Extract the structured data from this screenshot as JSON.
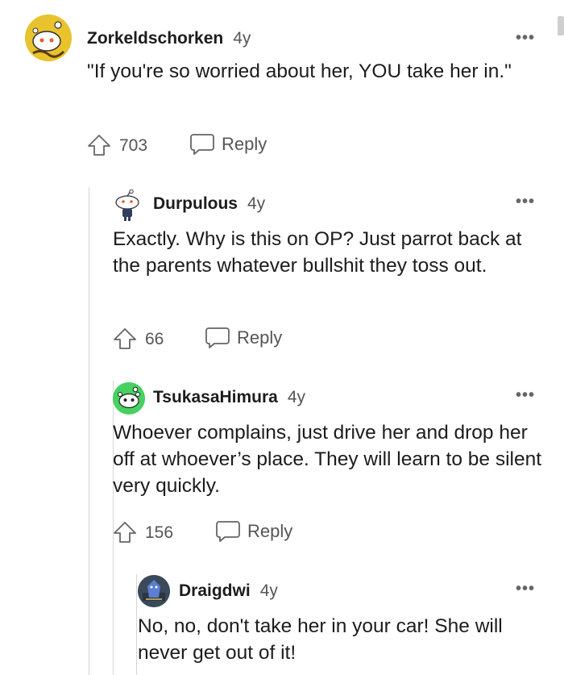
{
  "comments": [
    {
      "username": "Zorkeldschorken",
      "age": "4y",
      "body": "\"If you're so worried about her, YOU take her in.\"",
      "upvotes": "703",
      "reply_label": "Reply",
      "avatar_color": "#e8c32d"
    },
    {
      "username": "Durpulous",
      "age": "4y",
      "body": "Exactly. Why is this on OP? Just parrot back at the parents whatever bullshit they toss out.",
      "upvotes": "66",
      "reply_label": "Reply",
      "avatar_color": "#ffffff"
    },
    {
      "username": "TsukasaHimura",
      "age": "4y",
      "body": "Whoever complains, just drive her and drop her off at whoever’s place. They will learn to be silent very quickly.",
      "upvotes": "156",
      "reply_label": "Reply",
      "avatar_color": "#46d160"
    },
    {
      "username": "Draigdwi",
      "age": "4y",
      "body": "No, no, don't take her in your car! She will never get out of it!",
      "avatar_color": "#3b4a5a"
    }
  ],
  "more_options_label": "•••",
  "icons": {
    "upvote": "upvote-arrow-icon",
    "reply": "speech-bubble-icon",
    "more": "more-options-icon"
  }
}
